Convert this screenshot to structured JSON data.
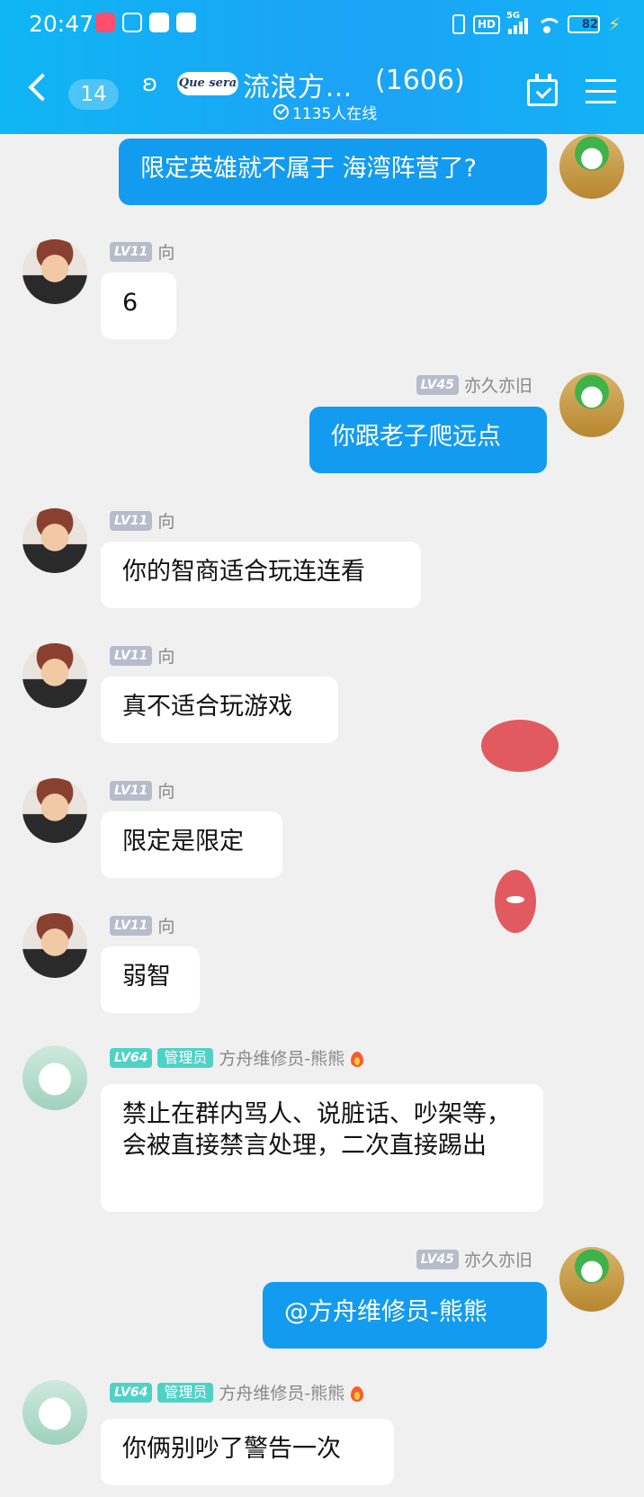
{
  "status_bar": {
    "time": "20:47",
    "network": "5G",
    "hd": "HD",
    "battery": "82"
  },
  "header": {
    "unread_count": "14",
    "logo_text": "Que sera",
    "group_name": "流浪方…",
    "member_count": "(1606)",
    "online_text": "1135人在线"
  },
  "messages": [
    {
      "side": "out",
      "text": "限定英雄就不属于 海湾阵营了?"
    },
    {
      "side": "in",
      "level": "LV11",
      "sender": "向",
      "text": "6"
    },
    {
      "side": "out",
      "level": "LV45",
      "sender": "亦久亦旧",
      "text": "你跟老子爬远点"
    },
    {
      "side": "in",
      "level": "LV11",
      "sender": "向",
      "text": "你的智商适合玩连连看"
    },
    {
      "side": "in",
      "level": "LV11",
      "sender": "向",
      "text": "真不适合玩游戏"
    },
    {
      "side": "in",
      "level": "LV11",
      "sender": "向",
      "text": "限定是限定"
    },
    {
      "side": "in",
      "level": "LV11",
      "sender": "向",
      "text": "弱智"
    },
    {
      "side": "in",
      "level": "LV64",
      "role": "管理员",
      "sender": "方舟维修员-熊熊",
      "text": "禁止在群内骂人、说脏话、吵架等，会被直接禁言处理，二次直接踢出"
    },
    {
      "side": "out",
      "level": "LV45",
      "sender": "亦久亦旧",
      "text": "@方舟维修员-熊熊"
    },
    {
      "side": "in",
      "level": "LV64",
      "role": "管理员",
      "sender": "方舟维修员-熊熊",
      "text": "你俩别吵了警告一次"
    }
  ]
}
